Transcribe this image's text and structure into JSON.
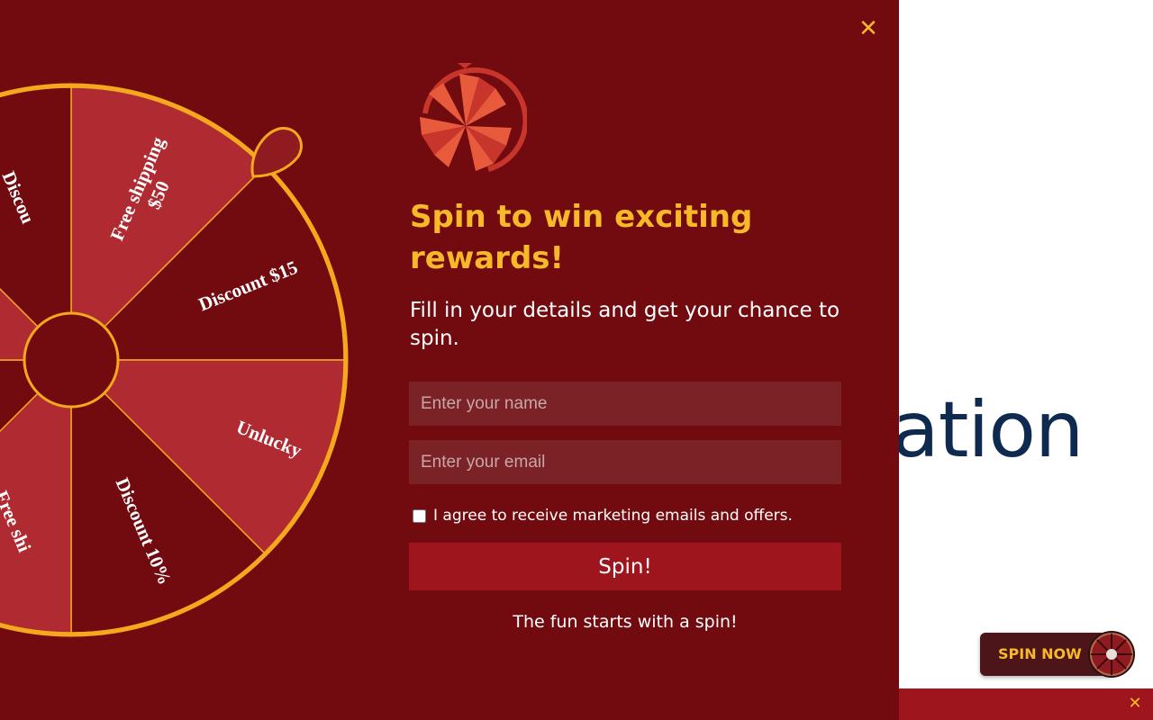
{
  "background": {
    "partial_heading": "ation"
  },
  "popup": {
    "close_icon": "close-icon",
    "wheel": {
      "segments": [
        {
          "label": "Free shipping",
          "label_line2": "$50"
        },
        {
          "label": "Discount $15"
        },
        {
          "label": "Unlucky"
        },
        {
          "label": "Discount 10%"
        },
        {
          "label": "Free shi"
        },
        {
          "label": "Discou"
        }
      ],
      "colors": {
        "light": "#b02a31",
        "dark": "#710b10",
        "border": "#f4a81d"
      }
    },
    "logo_icon": "wheel-logo-icon",
    "title": "Spin to win exciting rewards!",
    "subtitle": "Fill in your details and get your chance to spin.",
    "name_field": {
      "placeholder": "Enter your name",
      "value": ""
    },
    "email_field": {
      "placeholder": "Enter your email",
      "value": ""
    },
    "consent": {
      "label": "I agree to receive marketing emails and offers.",
      "checked": false
    },
    "spin_button": "Spin!",
    "tagline": "The fun starts with a spin!"
  },
  "spin_now_widget": {
    "label": "SPIN NOW",
    "icon": "mini-wheel-icon"
  },
  "bottom_bar": {
    "close_icon": "close-icon"
  },
  "colors": {
    "popup_bg": "#710b10",
    "accent": "#f7b92a",
    "button_bg": "#9f151d",
    "heading_navy": "#0f2a4f"
  }
}
